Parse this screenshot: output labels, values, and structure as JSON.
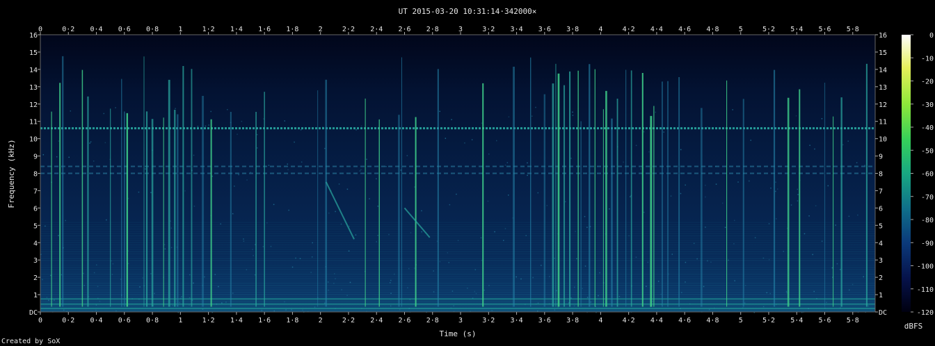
{
  "title": "UT 2015-03-20 10:31:14·342000×",
  "footer": "Created by SoX",
  "chart_data": {
    "type": "heatmap",
    "title": "UT 2015-03-20 10:31:14·342000×",
    "xlabel": "Time (s)",
    "ylabel": "Frequency (kHz)",
    "xlim": [
      0,
      5.96
    ],
    "ylim": [
      0,
      16
    ],
    "x_ticks": [
      "0",
      "0·2",
      "0·4",
      "0·6",
      "0·8",
      "1",
      "1·2",
      "1·4",
      "1·6",
      "1·8",
      "2",
      "2·2",
      "2·4",
      "2·6",
      "2·8",
      "3",
      "3·2",
      "3·4",
      "3·6",
      "3·8",
      "4",
      "4·2",
      "4·4",
      "4·6",
      "4·8",
      "5",
      "5·2",
      "5·4",
      "5·6",
      "5·8"
    ],
    "y_ticks": [
      "DC",
      "1",
      "2",
      "3",
      "4",
      "5",
      "6",
      "7",
      "8",
      "9",
      "10",
      "11",
      "12",
      "13",
      "14",
      "15",
      "16"
    ],
    "colorbar": {
      "label": "dBFS",
      "ticks": [
        "0",
        "-10",
        "-20",
        "-30",
        "-40",
        "-50",
        "-60",
        "-70",
        "-80",
        "-90",
        "-100",
        "-110",
        "-120"
      ],
      "range": [
        -120,
        0
      ],
      "colors": [
        "#000010",
        "#06124a",
        "#0b3a7a",
        "#0f6e8a",
        "#18a882",
        "#35d05a",
        "#8ee83a",
        "#e6f05a",
        "#ffffff"
      ]
    },
    "features": {
      "tone_line_khz": [
        10.6,
        8.4,
        8.0
      ],
      "vertical_clicks_s": [
        0.08,
        0.14,
        0.16,
        0.3,
        0.34,
        0.5,
        0.58,
        0.6,
        0.62,
        0.74,
        0.76,
        0.8,
        0.88,
        0.92,
        0.96,
        0.98,
        1.02,
        1.08,
        1.16,
        1.22,
        1.36,
        1.54,
        1.6,
        1.98,
        2.04,
        2.32,
        2.42,
        2.56,
        2.58,
        2.68,
        2.84,
        3.16,
        3.38,
        3.5,
        3.6,
        3.66,
        3.68,
        3.7,
        3.74,
        3.78,
        3.84,
        3.86,
        3.92,
        3.96,
        4.02,
        4.04,
        4.08,
        4.12,
        4.18,
        4.22,
        4.3,
        4.36,
        4.38,
        4.44,
        4.48,
        4.56,
        4.72,
        4.9,
        5.02,
        5.24,
        5.34,
        5.42,
        5.6,
        5.66,
        5.72,
        5.9
      ]
    }
  }
}
